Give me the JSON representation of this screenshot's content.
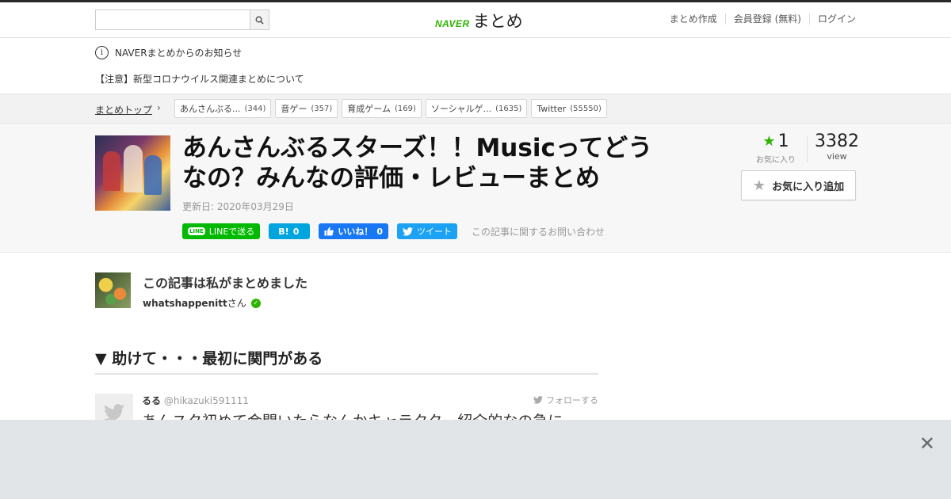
{
  "header": {
    "logo_brand": "NAVER",
    "logo_text": "まとめ",
    "search_placeholder": "",
    "nav": [
      "まとめ作成",
      "会員登録 (無料)",
      "ログイン"
    ]
  },
  "notice": {
    "label": "NAVERまとめからのお知らせ",
    "message": "【注意】新型コロナウイルス関連まとめについて"
  },
  "breadcrumb": {
    "top": "まとめトップ",
    "tags": [
      {
        "label": "あんさんぶる...",
        "count": "(344)"
      },
      {
        "label": "音ゲー",
        "count": "(357)"
      },
      {
        "label": "育成ゲーム",
        "count": "(169)"
      },
      {
        "label": "ソーシャルゲ...",
        "count": "(1635)"
      },
      {
        "label": "Twitter",
        "count": "(55550)"
      }
    ]
  },
  "article": {
    "title": "あんさんぶるスターズ！！Musicってどうなの？みんなの評価・レビューまとめ",
    "updated": "更新日: 2020年03月29日",
    "share": {
      "line_icon": "LINE",
      "line": "LINEで送る",
      "hatena_icon": "B!",
      "hatena_count": "0",
      "fb": "いいね！",
      "fb_count": "0",
      "tweet": "ツイート",
      "contact": "この記事に関するお問い合わせ"
    },
    "favorites": "1",
    "favorites_label": "お気に入り",
    "views": "3382",
    "views_label": "view",
    "fav_button": "お気に入り追加"
  },
  "author": {
    "heading": "この記事は私がまとめました",
    "name": "whatshappenitt",
    "suffix": "さん"
  },
  "section": {
    "heading": "▼ 助けて・・・最初に関門がある"
  },
  "tweet": {
    "name": "るる",
    "handle": "@hikazuki591111",
    "follow": "フォローする",
    "text": "あんスタ初めて会開いたらなんかキャラクター紹介的なの急に"
  },
  "colors": {
    "brand_green": "#2db400",
    "line_green": "#00b900",
    "hatena_blue": "#00a4de",
    "fb_blue": "#1877f2",
    "twitter_blue": "#1da1f2"
  }
}
